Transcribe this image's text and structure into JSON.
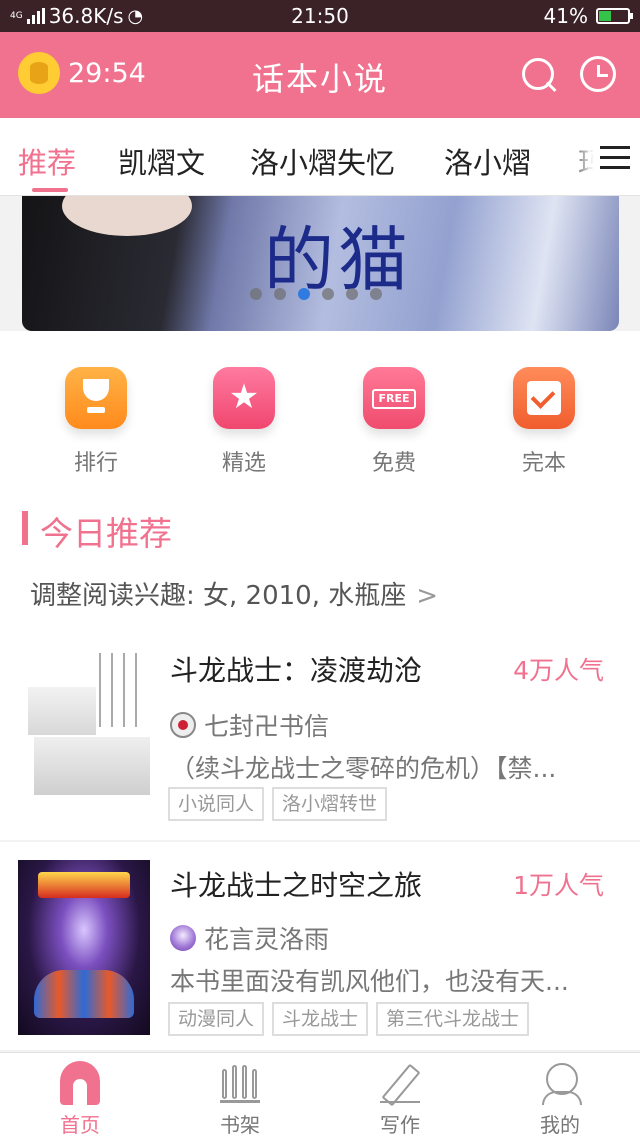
{
  "status_bar": {
    "network_tag": "4G",
    "speed": "36.8K/s",
    "time": "21:50",
    "battery": "41%",
    "battery_level": 0.41
  },
  "header": {
    "timer": "29:54",
    "title": "话本小说",
    "icons": [
      "alarm-icon",
      "search-icon",
      "clock-icon"
    ]
  },
  "tabs": [
    {
      "label": "推荐",
      "active": true
    },
    {
      "label": "凯熠文"
    },
    {
      "label": "洛小熠失忆"
    },
    {
      "label": "洛小熠"
    },
    {
      "label": "玛"
    }
  ],
  "banner": {
    "title": "的猫",
    "dot_count": 6,
    "active_dot": 3
  },
  "categories": [
    {
      "label": "排行",
      "icon": "trophy-icon"
    },
    {
      "label": "精选",
      "icon": "star-icon"
    },
    {
      "label": "免费",
      "icon": "free-icon",
      "badge": "FREE"
    },
    {
      "label": "完本",
      "icon": "check-icon"
    }
  ],
  "recommend": {
    "title": "今日推荐",
    "adjust": "调整阅读兴趣: 女, 2010, 水瓶座",
    "chevron": ">"
  },
  "books": [
    {
      "title": "斗龙战士：凌渡劫沧",
      "popularity": "4万人气",
      "author": "七封卍书信",
      "description": "（续斗龙战士之零碎的危机）【禁...",
      "tags": [
        "小说同人",
        "洛小熠转世"
      ]
    },
    {
      "title": "斗龙战士之时空之旅",
      "popularity": "1万人气",
      "author": "花言灵洛雨",
      "description": "本书里面没有凯风他们，也没有天...",
      "tags": [
        "动漫同人",
        "斗龙战士",
        "第三代斗龙战士"
      ]
    }
  ],
  "bottom_nav": [
    {
      "label": "首页",
      "icon": "home-icon",
      "active": true
    },
    {
      "label": "书架",
      "icon": "bookshelf-icon"
    },
    {
      "label": "写作",
      "icon": "pen-icon"
    },
    {
      "label": "我的",
      "icon": "profile-icon"
    }
  ],
  "colors": {
    "accent": "#f0728f",
    "status_bar": "#3a2226"
  }
}
